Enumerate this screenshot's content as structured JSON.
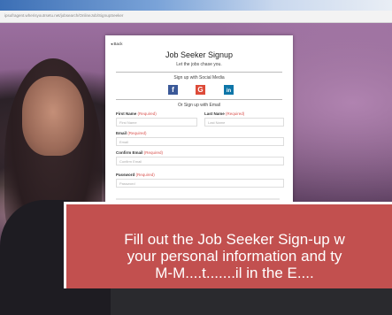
{
  "browser": {
    "url": "ipsufragent.wherisyoutrsetu.net/jobsearch/OnlineJob/SignupSeeker"
  },
  "form": {
    "back_label": "Back",
    "title": "Job Seeker Signup",
    "subtitle": "Let the jobs chase you.",
    "social_heading": "Sign up with Social Media",
    "social": [
      {
        "name": "facebook",
        "glyph": "f",
        "color": "#3b5998"
      },
      {
        "name": "google",
        "glyph": "G",
        "color": "#dd4b39"
      },
      {
        "name": "linkedin",
        "glyph": "in",
        "color": "#0e76a8"
      }
    ],
    "email_heading": "Or Sign up with Email",
    "required_tag": "(Required)",
    "first_name": {
      "label": "First Name",
      "placeholder": "First Name"
    },
    "last_name": {
      "label": "Last Name",
      "placeholder": "Last Name"
    },
    "email": {
      "label": "Email",
      "placeholder": "Email"
    },
    "confirm_email": {
      "label": "Confirm Email",
      "placeholder": "Confirm Email"
    },
    "password": {
      "label": "Password",
      "placeholder": "Password"
    }
  },
  "caption": {
    "line1": "Fill out the Job Seeker Sign-up w",
    "line2": "your personal information and ty",
    "line3": "M-M....t.......il in the E....",
    "background": "#c2504f"
  }
}
